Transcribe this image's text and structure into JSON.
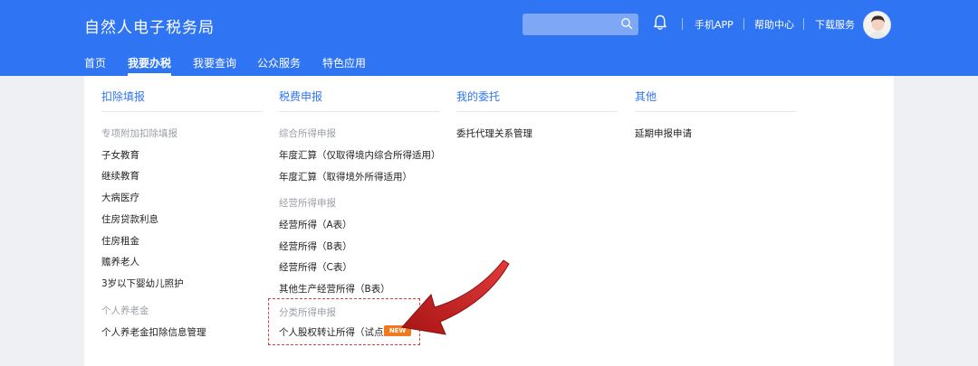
{
  "header": {
    "site_title": "自然人电子税务局",
    "search_placeholder": "",
    "links": [
      "手机APP",
      "帮助中心",
      "下载服务"
    ]
  },
  "nav": {
    "items": [
      "首页",
      "我要办税",
      "我要查询",
      "公众服务",
      "特色应用"
    ],
    "active_index": 1
  },
  "menu": {
    "col1": {
      "title": "扣除填报",
      "group1_title": "专项附加扣除填报",
      "group1_items": [
        "子女教育",
        "继续教育",
        "大病医疗",
        "住房贷款利息",
        "住房租金",
        "赡养老人",
        "3岁以下婴幼儿照护"
      ],
      "group2_title": "个人养老金",
      "group2_items": [
        "个人养老金扣除信息管理"
      ]
    },
    "col2": {
      "title": "税费申报",
      "group1_title": "综合所得申报",
      "group1_items": [
        "年度汇算（仅取得境内综合所得适用）",
        "年度汇算（取得境外所得适用）"
      ],
      "group2_title": "经营所得申报",
      "group2_items": [
        "经营所得（A表）",
        "经营所得（B表）",
        "经营所得（C表）",
        "其他生产经营所得（B表）"
      ],
      "group3_title": "分类所得申报",
      "group3_items": [
        "个人股权转让所得（试点）"
      ],
      "badge": "NEW"
    },
    "col3": {
      "title": "我的委托",
      "items": [
        "委托代理关系管理"
      ]
    },
    "col4": {
      "title": "其他",
      "items": [
        "延期申报申请"
      ]
    }
  },
  "colors": {
    "brand_blue": "#2f74f3",
    "badge_orange": "#f07a1e",
    "annotation_red": "#d84040"
  }
}
